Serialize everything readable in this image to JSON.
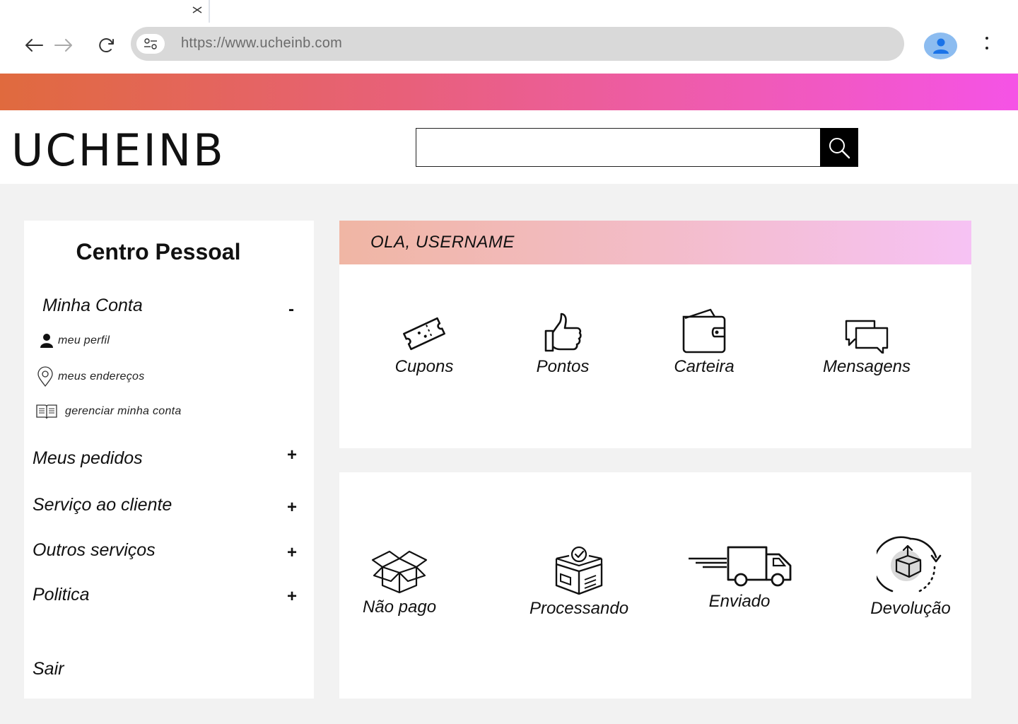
{
  "browser": {
    "url": "https://www.ucheinb.com",
    "icons": [
      "close-icon",
      "back-arrow-icon",
      "forward-arrow-icon",
      "reload-icon",
      "site-settings-icon",
      "profile-icon",
      "more-vert-icon"
    ]
  },
  "colors": {
    "banner_start": "#e06a3e",
    "banner_end": "#f553e6",
    "greeting_start": "#f0b6a4",
    "greeting_end": "#f6c2f4",
    "search_button": "#000000",
    "profile_avatar": "#8cbcf0"
  },
  "header": {
    "logo": "UCHEINB",
    "search_value": ""
  },
  "sidebar": {
    "title": "Centro Pessoal",
    "account": {
      "label": "Minha Conta",
      "toggle": "-",
      "items": [
        {
          "label": "meu perfil",
          "icon": "user-icon"
        },
        {
          "label": "meus endereços",
          "icon": "location-pin-icon"
        },
        {
          "label": "gerenciar minha conta",
          "icon": "book-icon"
        }
      ]
    },
    "sections": [
      {
        "label": "Meus pedidos",
        "toggle": "+"
      },
      {
        "label": "Serviço ao cliente",
        "toggle": "+"
      },
      {
        "label": "Outros serviços",
        "toggle": "+"
      },
      {
        "label": "Politica",
        "toggle": "+"
      }
    ],
    "logout": "Sair"
  },
  "greeting": "OLA, USERNAME",
  "assets": [
    {
      "label": "Cupons",
      "icon": "ticket-icon"
    },
    {
      "label": "Pontos",
      "icon": "thumbs-up-icon"
    },
    {
      "label": "Carteira",
      "icon": "wallet-icon"
    },
    {
      "label": "Mensagens",
      "icon": "chat-bubbles-icon"
    }
  ],
  "orders": [
    {
      "label": "Não pago",
      "icon": "open-box-icon"
    },
    {
      "label": "Processando",
      "icon": "box-check-icon"
    },
    {
      "label": "Enviado",
      "icon": "delivery-truck-icon"
    },
    {
      "label": "Devolução",
      "icon": "return-box-icon"
    }
  ]
}
